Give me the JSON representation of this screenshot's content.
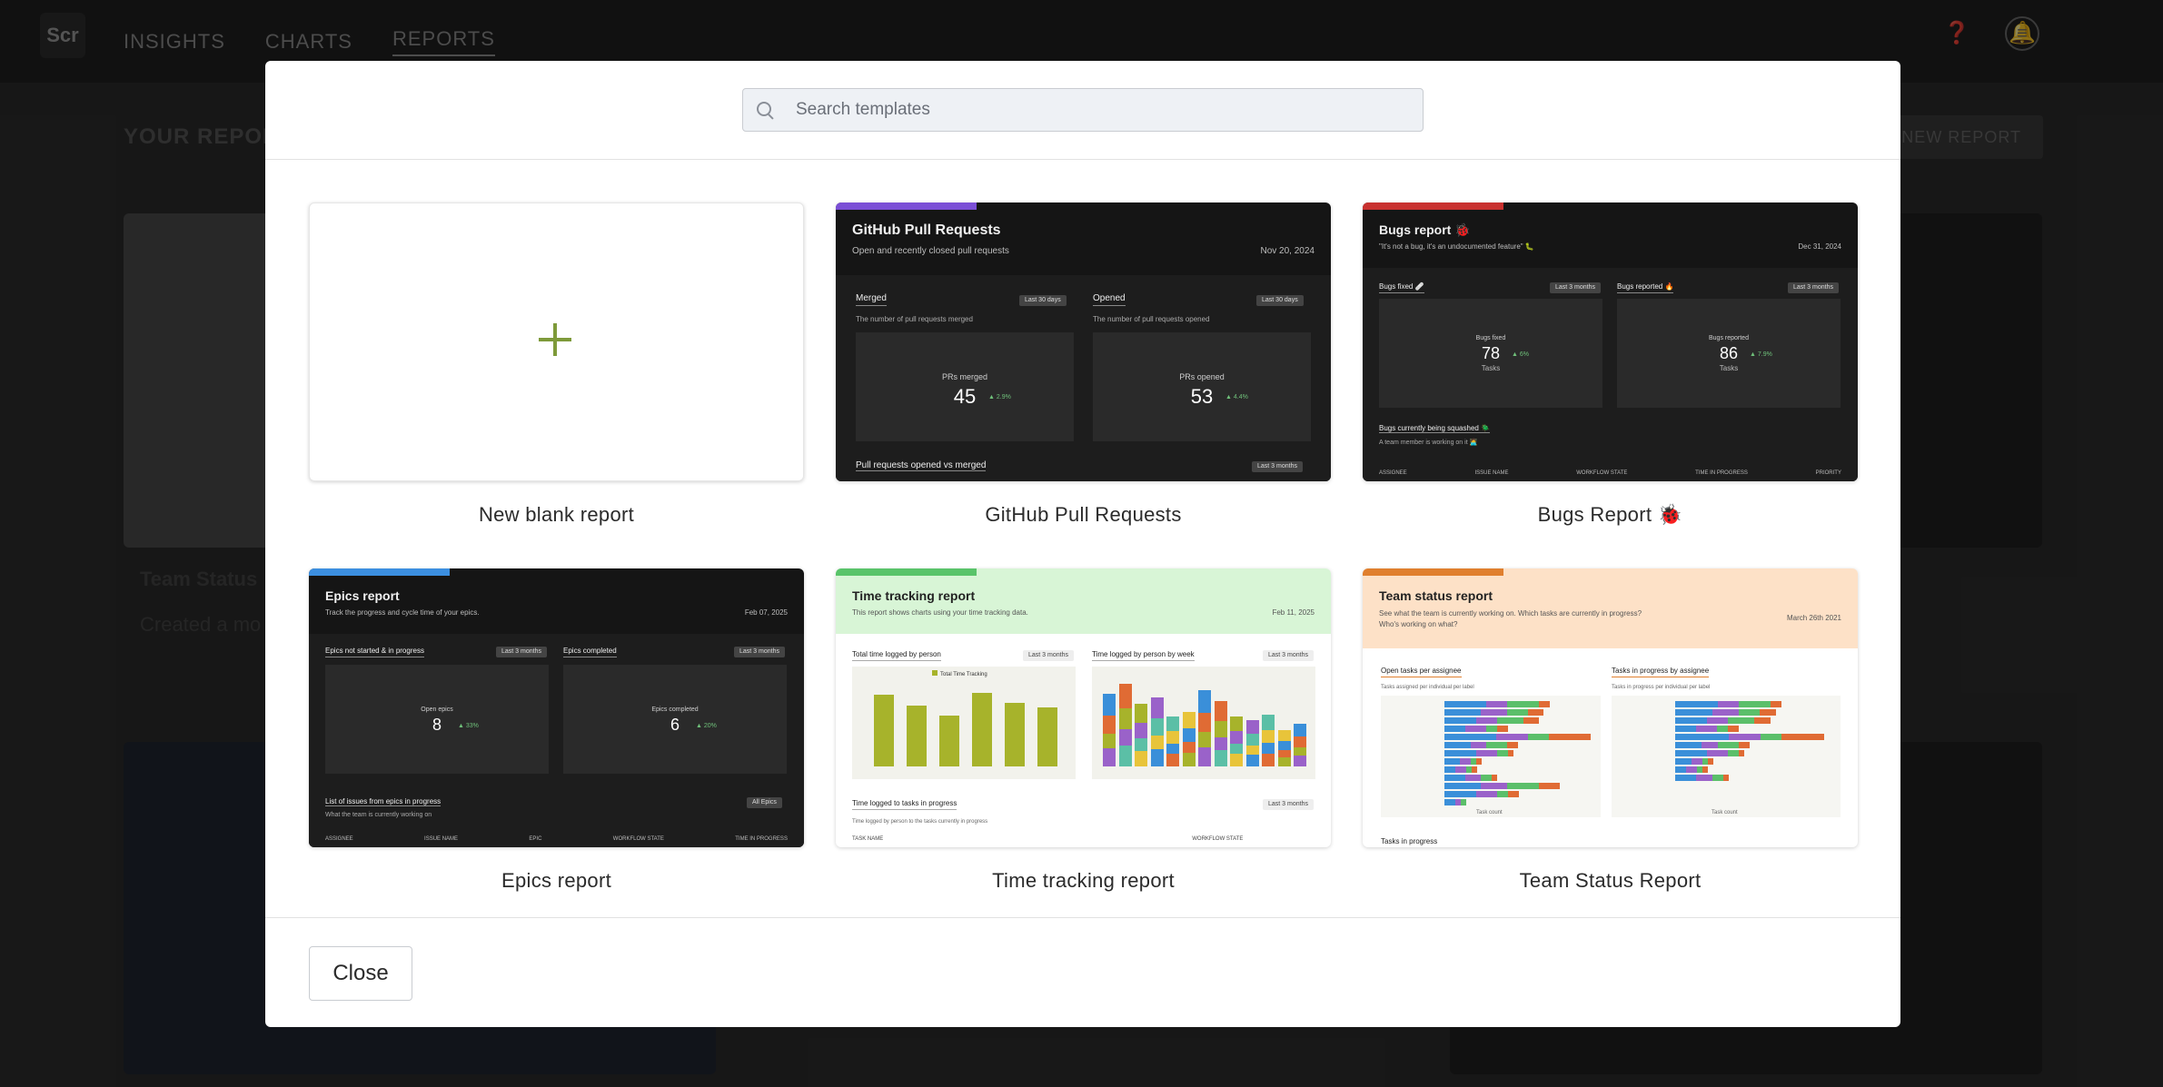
{
  "app": {
    "logo_text": "Scr",
    "nav": [
      "INSIGHTS",
      "CHARTS",
      "REPORTS"
    ],
    "page_title": "YOUR REPORTS",
    "new_report_label": "+ NEW REPORT",
    "bg_card_title": "Team Status",
    "bg_card_sub": "Created a mo"
  },
  "search": {
    "placeholder": "Search templates"
  },
  "templates": [
    {
      "name": "New blank report"
    },
    {
      "name": "GitHub Pull Requests",
      "accent": "#7b4fd6",
      "title": "GitHub Pull Requests",
      "subtitle": "Open and recently closed pull requests",
      "date": "Nov 20, 2024",
      "panel_a": {
        "title": "Merged",
        "sub": "The number of pull requests merged",
        "filter": "Last 30 days",
        "kpi_label": "PRs merged",
        "kpi_value": "45",
        "kpi_trend": "▲ 2.9%"
      },
      "panel_b": {
        "title": "Opened",
        "sub": "The number of pull requests opened",
        "filter": "Last 30 days",
        "kpi_label": "PRs opened",
        "kpi_value": "53",
        "kpi_trend": "▲ 4.4%"
      },
      "footer": "Pull requests opened vs merged",
      "footer_filter": "Last 3 months"
    },
    {
      "name": "Bugs Report 🐞",
      "accent": "#c8312f",
      "title": "Bugs report 🐞",
      "subtitle": "\"It's not a bug, it's an undocumented feature\" 🐛",
      "date": "Dec 31, 2024",
      "panel_a": {
        "title": "Bugs fixed 🩹",
        "filter": "Last 3 months",
        "kpi_label": "Bugs fixed",
        "kpi_value": "78",
        "kpi_trend": "▲ 6%",
        "kpi_cap": "Tasks"
      },
      "panel_b": {
        "title": "Bugs reported 🔥",
        "filter": "Last 3 months",
        "kpi_label": "Bugs reported",
        "kpi_value": "86",
        "kpi_trend": "▲ 7.9%",
        "kpi_cap": "Tasks"
      },
      "footer": "Bugs currently being squashed 🪲",
      "footer_sub": "A team member is working on it 🧑‍💻",
      "columns": [
        "ASSIGNEE",
        "ISSUE NAME",
        "WORKFLOW STATE",
        "TIME IN PROGRESS",
        "PRIORITY"
      ]
    },
    {
      "name": "Epics report",
      "accent": "#3c8fe0",
      "title": "Epics report",
      "subtitle": "Track the progress and cycle time of your epics.",
      "date": "Feb 07, 2025",
      "panel_a": {
        "title": "Epics not started & in progress",
        "filter": "Last 3 months",
        "kpi_label": "Open epics",
        "kpi_value": "8",
        "kpi_trend": "▲ 33%"
      },
      "panel_b": {
        "title": "Epics completed",
        "filter": "Last 3 months",
        "kpi_label": "Epics completed",
        "kpi_value": "6",
        "kpi_trend": "▲ 20%"
      },
      "footer": "List of issues from epics in progress",
      "footer_sub": "What the team is currently working on",
      "footer_filter": "All Epics",
      "columns": [
        "ASSIGNEE",
        "ISSUE NAME",
        "EPIC",
        "WORKFLOW STATE",
        "TIME IN PROGRESS"
      ]
    },
    {
      "name": "Time tracking report",
      "accent": "#59c46a",
      "head_color": "#d8f5d6",
      "title": "Time tracking report",
      "subtitle": "This report shows charts using your time tracking data.",
      "date": "Feb 11, 2025",
      "chart_a": {
        "title": "Total time logged by person",
        "filter": "Last 3 months",
        "legend": "Total Time Tracking",
        "values": [
          44,
          37,
          31,
          45,
          39,
          36
        ]
      },
      "chart_b": {
        "title": "Time logged by person by week",
        "filter": "Last 3 months"
      },
      "footer": "Time logged to tasks in progress",
      "footer_sub": "Time logged by person to the tasks currently in progress",
      "footer_filter": "Last 3 months",
      "columns": [
        "TASK NAME",
        "WORKFLOW STATE"
      ]
    },
    {
      "name": "Team Status Report",
      "accent": "#e07f2e",
      "head_color": "#fde1c7",
      "title": "Team status report",
      "subtitle": "See what the team is currently working on. Which tasks are currently in progress? Who's working on what?",
      "date": "March 26th 2021",
      "chart_a": {
        "title": "Open tasks per assignee",
        "sub": "Tasks assigned per individual per label",
        "axis": "Task count"
      },
      "chart_b": {
        "title": "Tasks in progress by assignee",
        "sub": "Tasks in progress per individual per label",
        "axis": "Task count"
      },
      "footer": "Tasks in progress"
    }
  ],
  "footer": {
    "close_label": "Close"
  },
  "colors": {
    "accent_green": "#7e9a3a",
    "bar_olive": "#a7b32b"
  }
}
